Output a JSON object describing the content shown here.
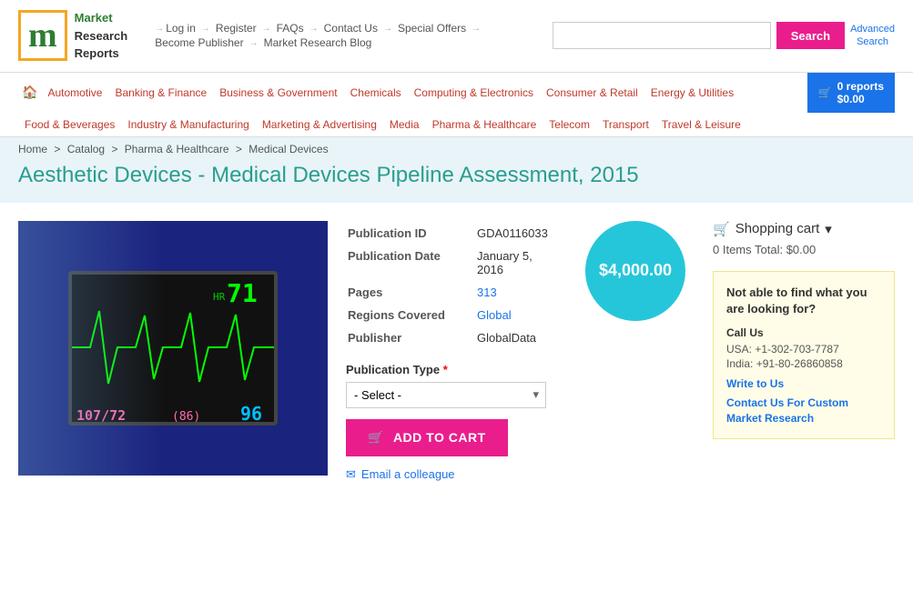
{
  "header": {
    "logo": {
      "letter": "m",
      "line1": "Market",
      "line2": "Research",
      "line3": "Reports"
    },
    "search": {
      "placeholder": "",
      "button_label": "Search",
      "advanced_label": "Advanced\nSearch"
    },
    "nav_links": [
      {
        "label": "Log in",
        "href": "#"
      },
      {
        "label": "Register",
        "href": "#"
      },
      {
        "label": "FAQs",
        "href": "#"
      },
      {
        "label": "Contact Us",
        "href": "#"
      },
      {
        "label": "Special Offers",
        "href": "#"
      },
      {
        "label": "Become Publisher",
        "href": "#"
      },
      {
        "label": "Market Research Blog",
        "href": "#"
      }
    ]
  },
  "category_nav": {
    "row1": [
      {
        "label": "Automotive"
      },
      {
        "label": "Banking & Finance"
      },
      {
        "label": "Business & Government"
      },
      {
        "label": "Chemicals"
      },
      {
        "label": "Computing & Electronics"
      },
      {
        "label": "Consumer & Retail"
      },
      {
        "label": "Energy & Utilities"
      }
    ],
    "row2": [
      {
        "label": "Food & Beverages"
      },
      {
        "label": "Industry & Manufacturing"
      },
      {
        "label": "Marketing & Advertising"
      },
      {
        "label": "Media"
      },
      {
        "label": "Pharma & Healthcare"
      },
      {
        "label": "Telecom"
      },
      {
        "label": "Transport"
      },
      {
        "label": "Travel & Leisure"
      }
    ],
    "cart": {
      "icon": "🛒",
      "reports": "0 reports",
      "total": "$0.00"
    }
  },
  "breadcrumb": {
    "items": [
      "Home",
      "Catalog",
      "Pharma & Healthcare",
      "Medical Devices"
    ]
  },
  "page_title": "Aesthetic Devices - Medical Devices Pipeline Assessment, 2015",
  "product": {
    "publication_id_label": "Publication ID",
    "publication_id_value": "GDA0116033",
    "publication_date_label": "Publication Date",
    "publication_date_value": "January 5, 2016",
    "pages_label": "Pages",
    "pages_value": "313",
    "regions_label": "Regions Covered",
    "regions_value": "Global",
    "publisher_label": "Publisher",
    "publisher_value": "GlobalData",
    "publication_type_label": "Publication Type",
    "publication_type_required": "*",
    "select_placeholder": "- Select -",
    "price": "$4,000.00",
    "add_to_cart_label": "ADD TO CART",
    "email_colleague_label": "Email a colleague"
  },
  "shopping_cart": {
    "header": "Shopping cart",
    "dropdown_icon": "▾",
    "items_label": "0 Items",
    "total_label": "Total: $0.00"
  },
  "help_box": {
    "heading": "Not able to find what you are looking for?",
    "call_us_label": "Call Us",
    "phone_usa": "USA: +1-302-703-7787",
    "phone_india": "India: +91-80-26860858",
    "write_to_us_label": "Write to Us",
    "contact_label": "Contact Us For Custom Market Research"
  }
}
